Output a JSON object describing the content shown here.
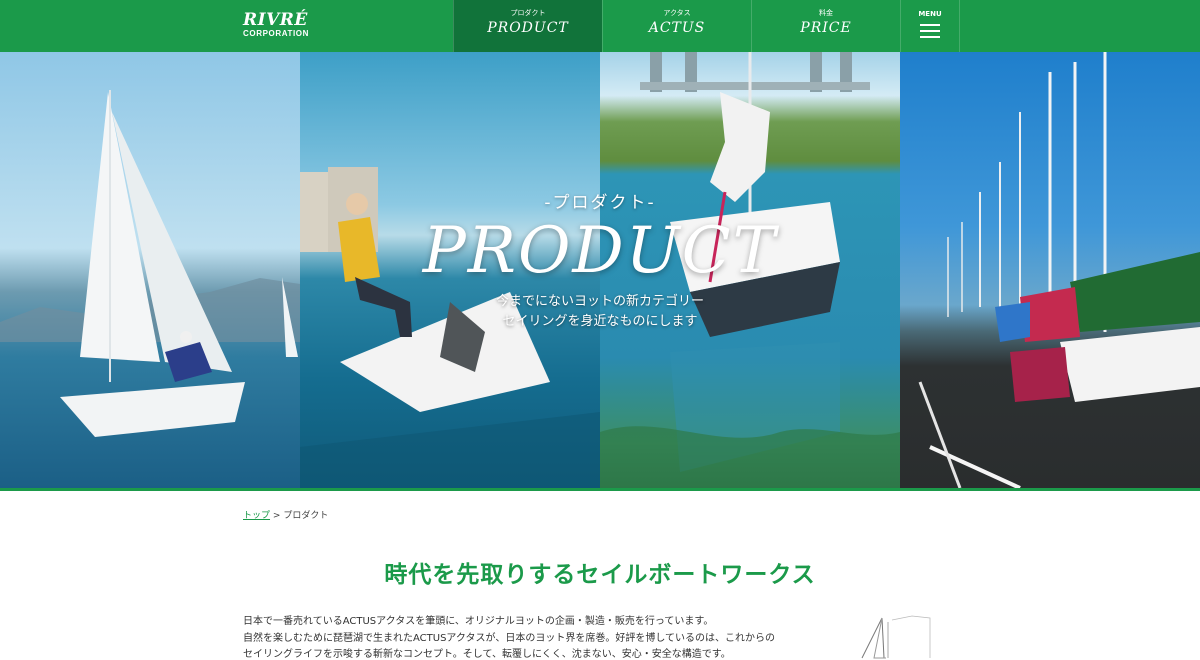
{
  "header": {
    "logo_main": "RIVRÉ",
    "logo_sub": "CORPORATION",
    "nav": [
      {
        "kana": "プロダクト",
        "en": "PRODUCT"
      },
      {
        "kana": "アクタス",
        "en": "ACTUS"
      },
      {
        "kana": "料金",
        "en": "PRICE"
      }
    ],
    "menu_label": "MENU"
  },
  "hero": {
    "subtitle": "-プロダクト-",
    "title": "PRODUCT",
    "desc_line1": "今までにないヨットの新カテゴリー",
    "desc_line2": "セイリングを身近なものにします"
  },
  "breadcrumb": {
    "home": "トップ",
    "separator": ">",
    "current": "プロダクト"
  },
  "section": {
    "title": "時代を先取りするセイルボートワークス",
    "paragraph_lines": [
      "日本で一番売れているACTUSアクタスを筆頭に、オリジナルヨットの企画・製造・販売を行っています。",
      "自然を楽しむために琵琶湖で生まれたACTUSアクタスが、日本のヨット界を席巻。好評を博しているのは、これからの",
      "セイリングライフを示唆する斬新なコンセプト。そして、転覆しにくく、沈まない、安心・安全な構造です。"
    ]
  },
  "colors": {
    "brand_green": "#1b9a4a",
    "nav_active": "#11733a"
  },
  "icons": {
    "menu": "hamburger-icon"
  }
}
